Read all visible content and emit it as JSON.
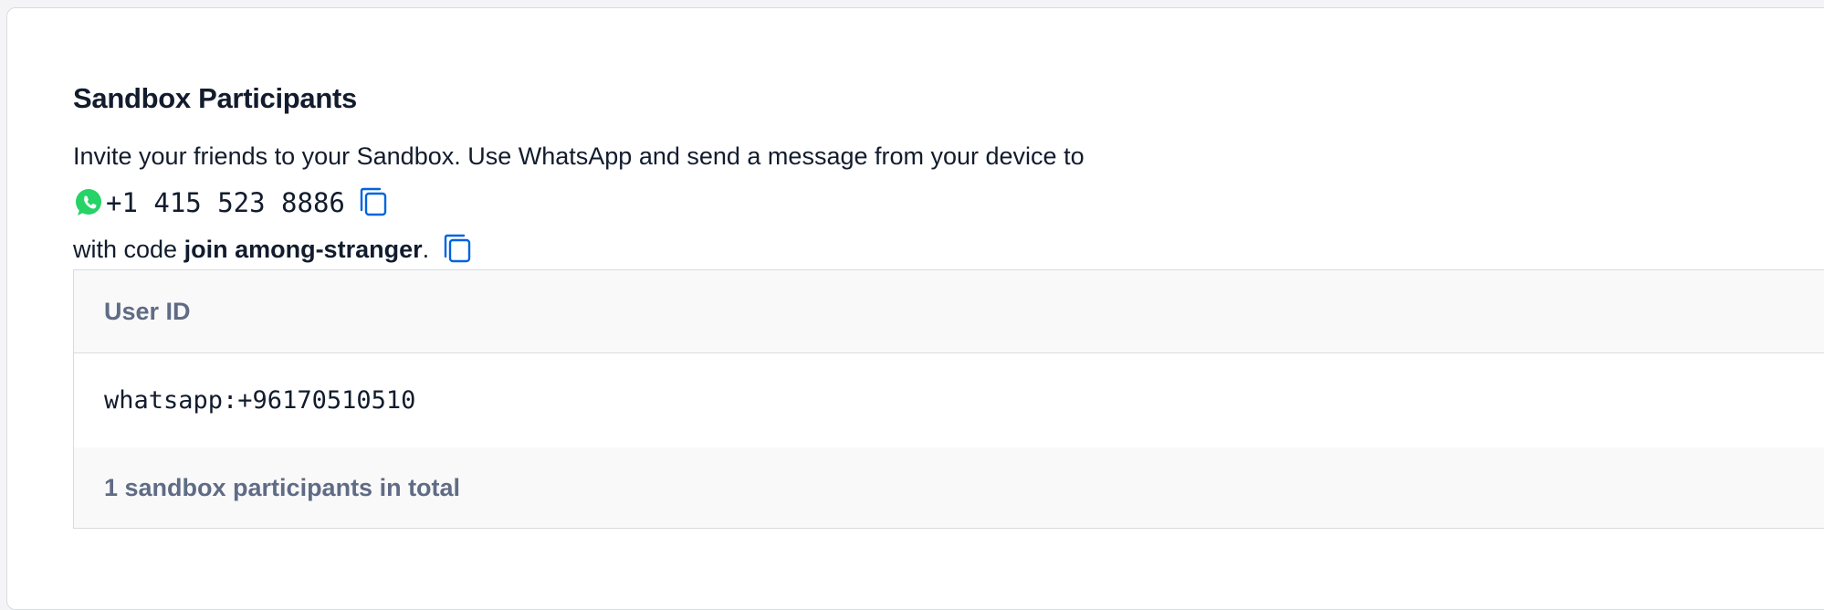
{
  "section": {
    "title": "Sandbox Participants",
    "intro": "Invite your friends to your Sandbox. Use WhatsApp and send a message from your device to",
    "phone_number": "+1 415 523 8886",
    "code_prefix": "with code ",
    "join_code": "join among-stranger",
    "code_suffix": "."
  },
  "icons": {
    "whatsapp": "whatsapp-icon",
    "copy": "copy-icon"
  },
  "colors": {
    "whatsapp_green": "#25d366",
    "copy_blue": "#0263e0",
    "muted_text": "#606b85"
  },
  "table": {
    "header": "User ID",
    "rows": [
      "whatsapp:+96170510510"
    ],
    "footer": "1 sandbox participants in total"
  }
}
